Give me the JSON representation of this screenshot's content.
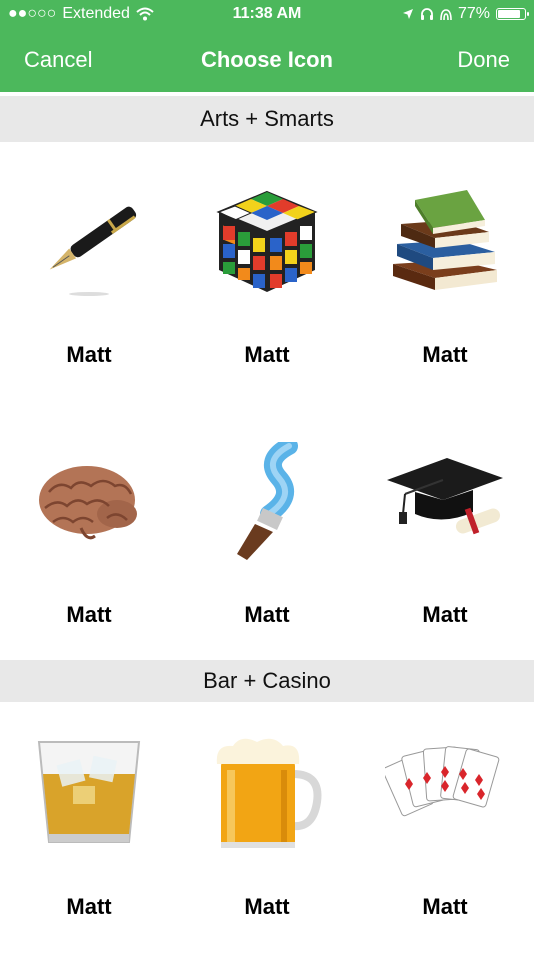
{
  "status_bar": {
    "carrier": "Extended",
    "time": "11:38 AM",
    "battery": "77%",
    "battery_level": 0.77
  },
  "nav": {
    "cancel": "Cancel",
    "title": "Choose Icon",
    "done": "Done"
  },
  "colors": {
    "accent": "#4cb85c",
    "section_bg": "#e8e8e8"
  },
  "sections": [
    {
      "title": "Arts + Smarts",
      "items": [
        {
          "label": "Matt",
          "icon": "fountain-pen-icon"
        },
        {
          "label": "Matt",
          "icon": "rubiks-cube-icon"
        },
        {
          "label": "Matt",
          "icon": "books-icon"
        },
        {
          "label": "Matt",
          "icon": "brain-icon"
        },
        {
          "label": "Matt",
          "icon": "paintbrush-icon"
        },
        {
          "label": "Matt",
          "icon": "graduation-cap-icon"
        }
      ]
    },
    {
      "title": "Bar + Casino",
      "items": [
        {
          "label": "Matt",
          "icon": "whiskey-glass-icon"
        },
        {
          "label": "Matt",
          "icon": "beer-mug-icon"
        },
        {
          "label": "Matt",
          "icon": "playing-cards-icon"
        }
      ]
    }
  ]
}
